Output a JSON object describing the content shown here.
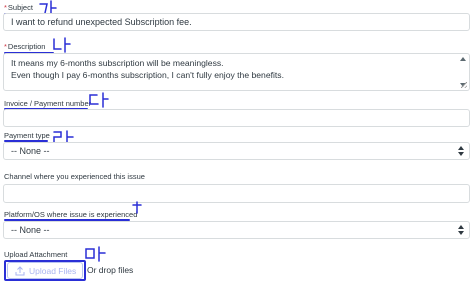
{
  "form": {
    "subject": {
      "required_mark": "*",
      "label": "Subject",
      "value": "I want to refund unexpected Subscription fee."
    },
    "description": {
      "required_mark": "*",
      "label": "Description",
      "lines": [
        "It means my 6-months subscription will be meaningless.",
        "Even though I pay 6-months subscription, I can't fully enjoy the benefits."
      ]
    },
    "invoice": {
      "label": "Invoice / Payment number",
      "value": ""
    },
    "payment_type": {
      "label": "Payment type",
      "selected": "-- None --"
    },
    "channel": {
      "label": "Channel where you experienced this issue"
    },
    "platform": {
      "label": "Platform/OS where issue is experienced",
      "selected": "-- None --"
    },
    "attachment": {
      "label": "Upload Attachment",
      "button_label": "Upload Files",
      "drop_text": "Or drop files"
    }
  },
  "annotations": {
    "subject": "가",
    "description": "나",
    "invoice": "다",
    "payment_type": "라",
    "platform": "t",
    "attachment": "마"
  },
  "colors": {
    "annotation": "#2a2fd6",
    "required": "#cc3340",
    "border": "#d8dcde",
    "upload_text": "#aab5f0"
  },
  "icons": {
    "upload": "upload-icon",
    "select_arrows": "chevron-up-down-icon",
    "resize": "resize-grip-icon"
  }
}
